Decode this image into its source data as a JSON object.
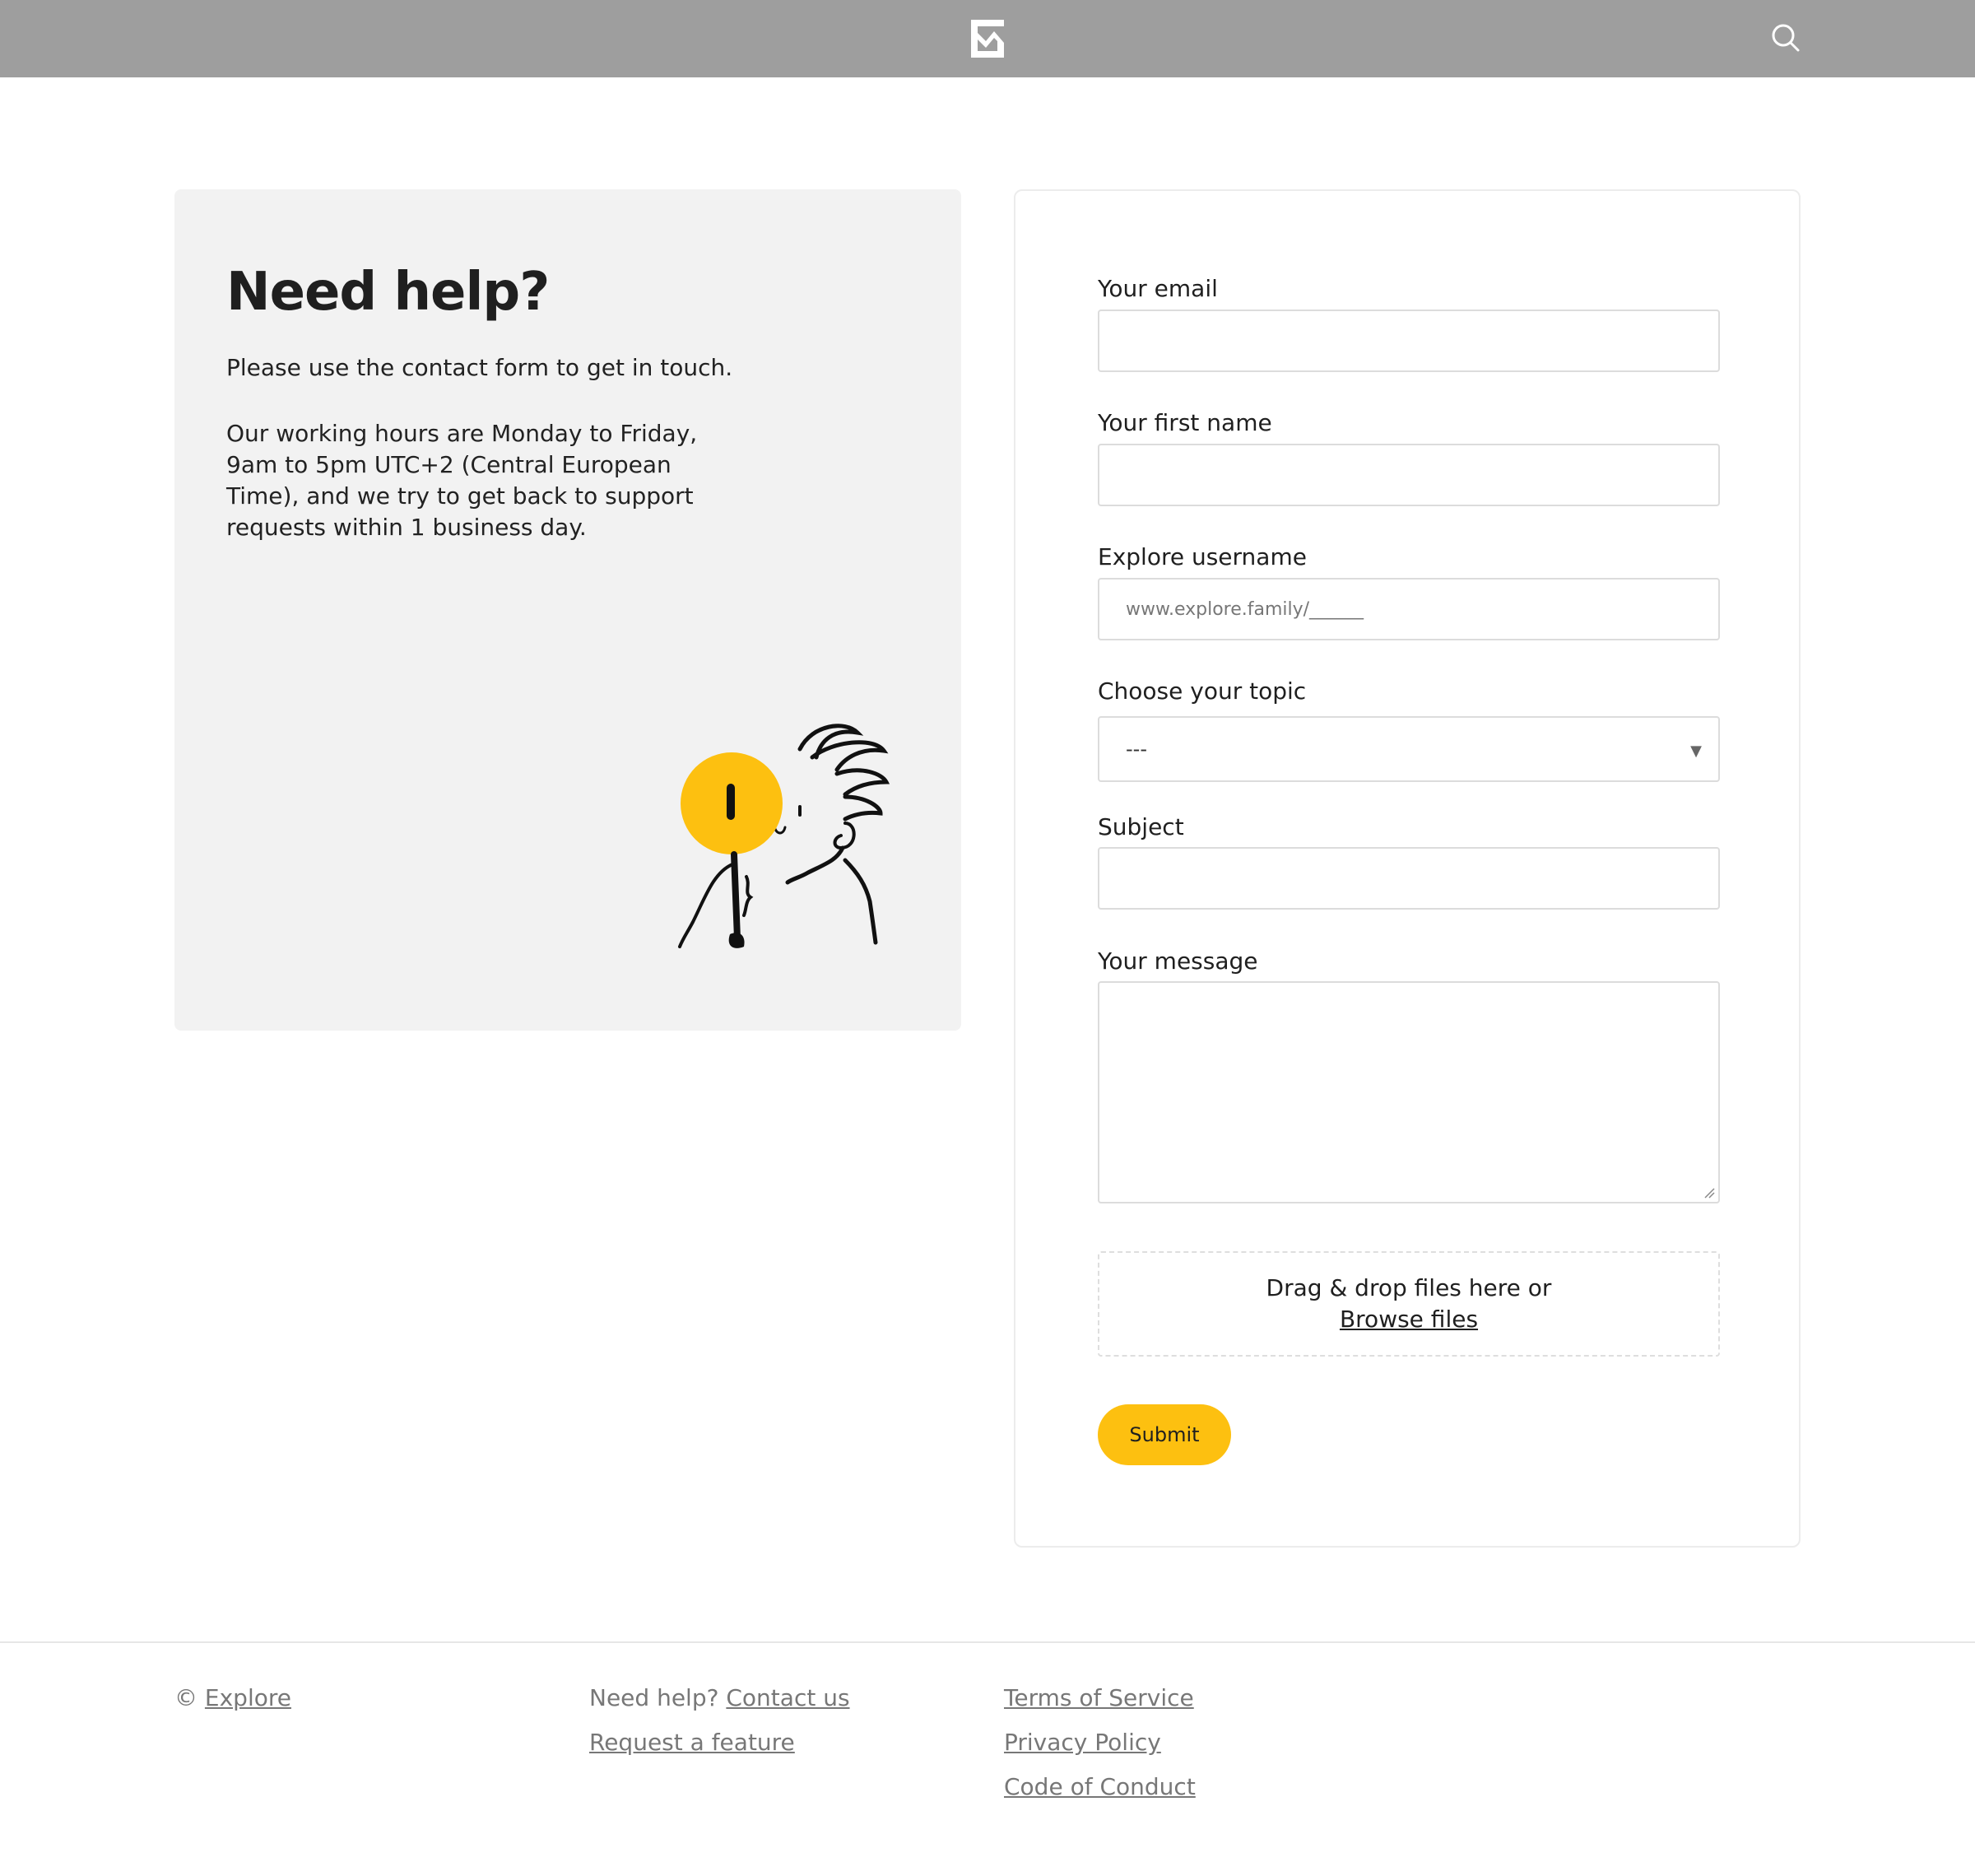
{
  "header": {
    "logo_icon": "explore-logo-icon",
    "search_icon": "search-icon",
    "background_color": "#9e9e9e"
  },
  "help": {
    "title": "Need help?",
    "paragraph_1": "Please use the contact form to get in touch.",
    "paragraph_2": "Our working hours are Monday to Friday, 9am to 5pm UTC+2 (Central European Time), and we try to get back to support requests within 1 business day.",
    "illustration_icon": "person-with-magnifier-illustration"
  },
  "form": {
    "email_label": "Your email",
    "first_name_label": "Your first name",
    "username_label": "Explore username",
    "username_placeholder": "www.explore.family/______",
    "topic_label": "Choose your topic",
    "topic_selected": "---",
    "subject_label": "Subject",
    "message_label": "Your message",
    "dropzone_text": "Drag & drop files here or",
    "browse_label": "Browse files",
    "submit_label": "Submit",
    "accent_color": "#fdc010"
  },
  "footer": {
    "copyright_symbol": "©",
    "brand_link": "Explore",
    "need_help_text": "Need help?",
    "contact_link": "Contact us",
    "request_feature_link": "Request a feature",
    "terms_link": "Terms of Service",
    "privacy_link": "Privacy Policy",
    "conduct_link": "Code of Conduct"
  }
}
